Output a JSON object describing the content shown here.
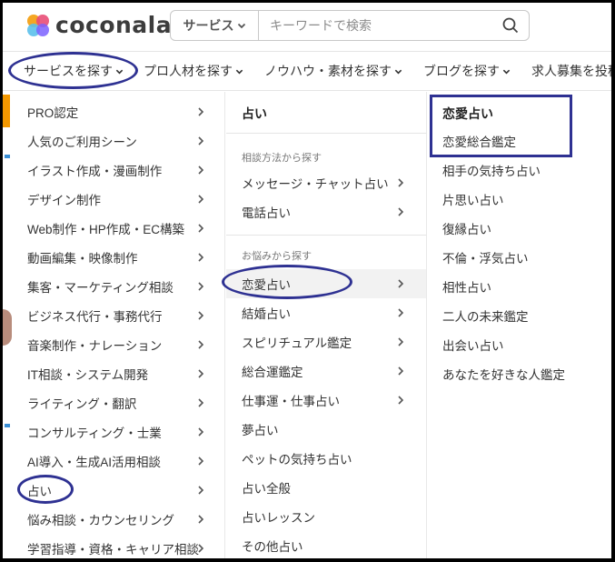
{
  "brand": {
    "name": "coconala",
    "colors": [
      "#f5a623",
      "#e94e77",
      "#5bc0eb",
      "#7b61ff"
    ]
  },
  "search": {
    "category_label": "サービス",
    "placeholder": "キーワードで検索"
  },
  "nav": {
    "items": [
      {
        "label": "サービスを探す"
      },
      {
        "label": "プロ人材を探す"
      },
      {
        "label": "ノウハウ・素材を探す"
      },
      {
        "label": "ブログを探す"
      },
      {
        "label": "求人募集を投稿す"
      }
    ]
  },
  "categories": [
    {
      "label": "PRO認定"
    },
    {
      "label": "人気のご利用シーン"
    },
    {
      "label": "イラスト作成・漫画制作"
    },
    {
      "label": "デザイン制作"
    },
    {
      "label": "Web制作・HP作成・EC構築"
    },
    {
      "label": "動画編集・映像制作"
    },
    {
      "label": "集客・マーケティング相談"
    },
    {
      "label": "ビジネス代行・事務代行"
    },
    {
      "label": "音楽制作・ナレーション"
    },
    {
      "label": "IT相談・システム開発"
    },
    {
      "label": "ライティング・翻訳"
    },
    {
      "label": "コンサルティング・士業"
    },
    {
      "label": "AI導入・生成AI活用相談"
    },
    {
      "label": "占い"
    },
    {
      "label": "悩み相談・カウンセリング"
    },
    {
      "label": "学習指導・資格・キャリア相談"
    }
  ],
  "subcategory": {
    "title": "占い",
    "group1_heading": "相談方法から探す",
    "group1": [
      {
        "label": "メッセージ・チャット占い"
      },
      {
        "label": "電話占い"
      }
    ],
    "group2_heading": "お悩みから探す",
    "group2": [
      {
        "label": "恋愛占い"
      },
      {
        "label": "結婚占い"
      },
      {
        "label": "スピリチュアル鑑定"
      },
      {
        "label": "総合運鑑定"
      },
      {
        "label": "仕事運・仕事占い"
      },
      {
        "label": "夢占い"
      },
      {
        "label": "ペットの気持ち占い"
      },
      {
        "label": "占い全般"
      },
      {
        "label": "占いレッスン"
      },
      {
        "label": "その他占い"
      }
    ]
  },
  "detail": {
    "title": "恋愛占い",
    "items": [
      {
        "label": "恋愛総合鑑定"
      },
      {
        "label": "相手の気持ち占い"
      },
      {
        "label": "片思い占い"
      },
      {
        "label": "復縁占い"
      },
      {
        "label": "不倫・浮気占い"
      },
      {
        "label": "相性占い"
      },
      {
        "label": "二人の未来鑑定"
      },
      {
        "label": "出会い占い"
      },
      {
        "label": "あなたを好きな人鑑定"
      }
    ]
  },
  "annotation_color": "#2e3192"
}
